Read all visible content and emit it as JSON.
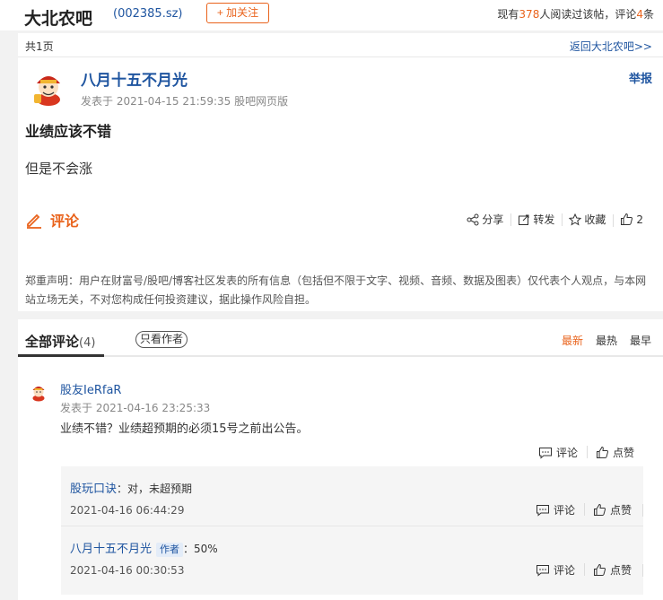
{
  "header": {
    "bar_name": "大北农吧",
    "bar_code": "(002385.sz)",
    "follow_label": "+ 加关注",
    "read_prefix": "现有",
    "read_count": "378",
    "read_mid": "人阅读过该帖，评论",
    "comment_count": "4",
    "read_suffix": "条"
  },
  "post": {
    "page_count": "共1页",
    "back_link": "返回大北农吧>>",
    "author": "八月十五不月光",
    "meta": "发表于 2021-04-15 21:59:35 股吧网页版",
    "report": "举报",
    "title": "业绩应该不错",
    "body": "但是不会涨",
    "comment_label": "评论",
    "actions": {
      "share": "分享",
      "forward": "转发",
      "collect": "收藏",
      "like_count": "2"
    },
    "disclaimer": "郑重声明：用户在财富号/股吧/博客社区发表的所有信息（包括但不限于文字、视频、音频、数据及图表）仅代表个人观点，与本网站立场无关，不对您构成任何投资建议，据此操作风险自担。"
  },
  "comments_section": {
    "title": "全部评论",
    "count": "(4)",
    "only_author": "只看作者",
    "sort": [
      "最新",
      "最热",
      "最早"
    ],
    "active_sort": "最新"
  },
  "comment": {
    "author": "股友IeRfaR",
    "time": "发表于 2021-04-16 23:25:33",
    "text": "业绩不错？业绩超预期的必须15号之前出公告。",
    "reply_label": "评论",
    "like_label": "点赞"
  },
  "replies": [
    {
      "user": "股玩口诀",
      "author_tag": "",
      "text": "：对，未超预期",
      "time": "2021-04-16 06:44:29",
      "reply_label": "评论",
      "like_label": "点赞"
    },
    {
      "user": "八月十五不月光",
      "author_tag": "作者",
      "text": "：50%",
      "time": "2021-04-16 00:30:53",
      "reply_label": "评论",
      "like_label": "点赞"
    }
  ],
  "colors": {
    "accent": "#e9631c",
    "link": "#1f55a0"
  }
}
